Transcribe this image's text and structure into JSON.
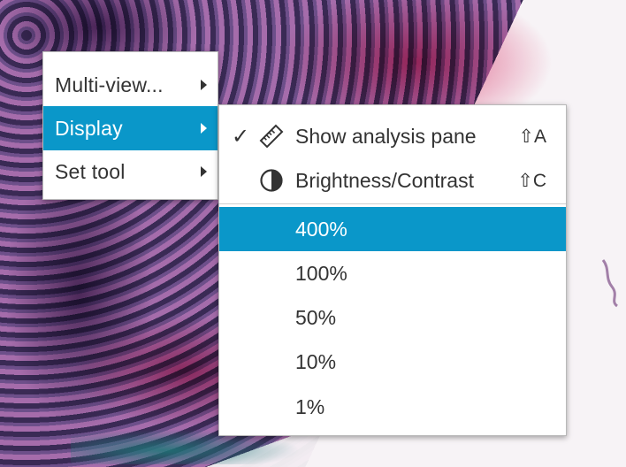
{
  "main_menu": {
    "items": [
      {
        "label": "Multi-view..."
      },
      {
        "label": "Display"
      },
      {
        "label": "Set tool"
      }
    ]
  },
  "display_submenu": {
    "items": [
      {
        "label": "Show analysis pane",
        "shortcut": "⇧A",
        "checked": true,
        "icon": "ruler-icon"
      },
      {
        "label": "Brightness/Contrast",
        "shortcut": "⇧C",
        "checked": false,
        "icon": "contrast-icon"
      }
    ],
    "zoom_options": [
      {
        "label": "400%",
        "selected": true
      },
      {
        "label": "100%"
      },
      {
        "label": "50%"
      },
      {
        "label": "10%"
      },
      {
        "label": "1%"
      }
    ],
    "check_glyph": "✓"
  },
  "colors": {
    "highlight": "#0a97c9"
  }
}
